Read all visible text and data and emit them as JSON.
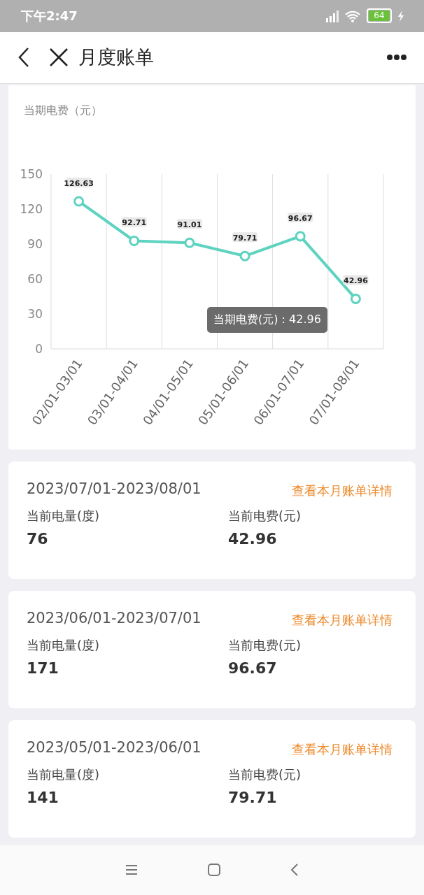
{
  "status_bar": {
    "time": "下午2:47",
    "battery": "64"
  },
  "nav_bar": {
    "title": "月度账单"
  },
  "chart_card": {
    "title": "当期电费（元）",
    "tooltip": {
      "separator": " : ",
      "value": "42.96"
    },
    "chart_data": {
      "type": "line",
      "categories": [
        "02/01-03/01",
        "03/01-04/01",
        "04/01-05/01",
        "05/01-06/01",
        "06/01-07/01",
        "07/01-08/01"
      ],
      "series": [
        {
          "name": "当期电费(元)",
          "color": "#5dd3c0",
          "marker": "circle",
          "values": [
            126.63,
            92.71,
            91.01,
            79.71,
            96.67,
            42.96
          ]
        }
      ],
      "ylim": [
        0,
        150
      ],
      "yticks": [
        0,
        30,
        60,
        90,
        120,
        150
      ],
      "data_labels": true
    }
  },
  "bills": [
    {
      "period": "2023/07/01-2023/08/01",
      "link": "查看本月账单详情",
      "usage_label": "当前电量(度)",
      "usage": "76",
      "fee_label": "当前电费(元)",
      "fee": "42.96"
    },
    {
      "period": "2023/06/01-2023/07/01",
      "link": "查看本月账单详情",
      "usage_label": "当前电量(度)",
      "usage": "171",
      "fee_label": "当前电费(元)",
      "fee": "96.67"
    },
    {
      "period": "2023/05/01-2023/06/01",
      "link": "查看本月账单详情",
      "usage_label": "当前电量(度)",
      "usage": "141",
      "fee_label": "当前电费(元)",
      "fee": "79.71"
    }
  ]
}
